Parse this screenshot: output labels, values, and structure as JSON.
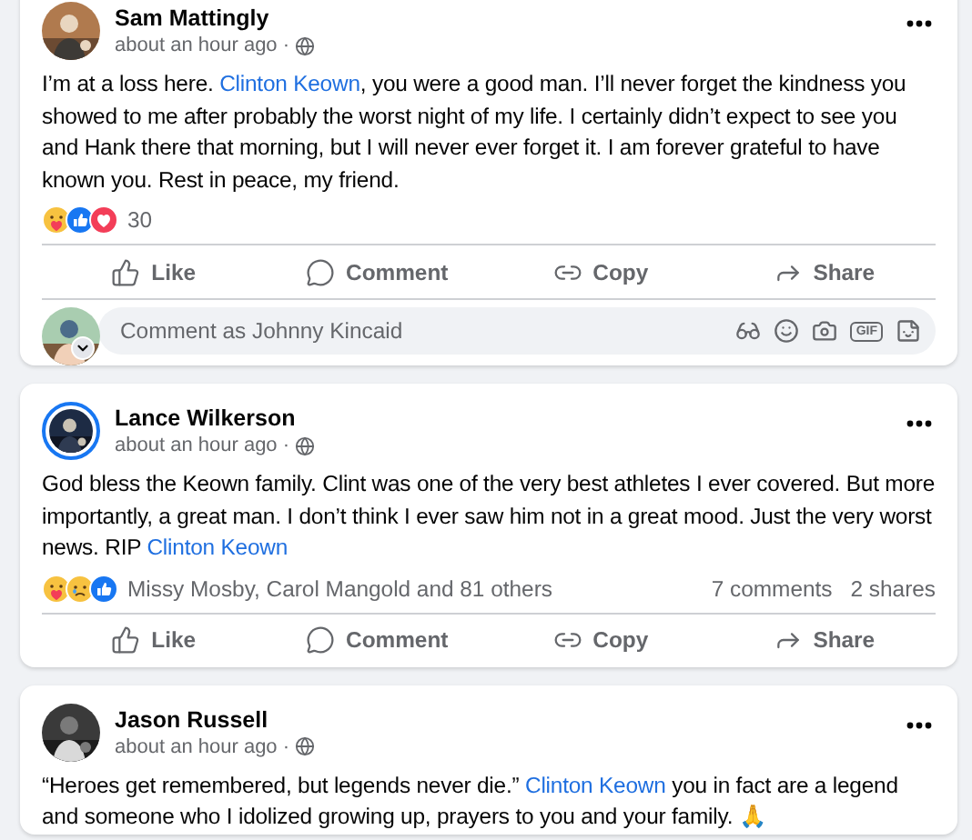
{
  "posts": [
    {
      "author": "Sam Mattingly",
      "time": "about an hour ago",
      "separator": "·",
      "story_ring": false,
      "body": [
        {
          "kind": "text",
          "text": "I’m at a loss here. "
        },
        {
          "kind": "mention",
          "text": "Clinton Keown"
        },
        {
          "kind": "text",
          "text": ", you were a good man. I’ll never forget the kindness you showed to me after probably the worst night of my life. I certainly didn’t expect to see you and Hank there that morning, but I will never ever forget it. I am forever grateful to have known you. Rest in peace, my friend."
        }
      ],
      "reactions": [
        {
          "kind": "care"
        },
        {
          "kind": "like"
        },
        {
          "kind": "love"
        }
      ],
      "reaction_summary": "30",
      "actions": [
        {
          "kind": "like",
          "label": "Like"
        },
        {
          "kind": "comment",
          "label": "Comment"
        },
        {
          "kind": "copy",
          "label": "Copy"
        },
        {
          "kind": "share",
          "label": "Share"
        }
      ],
      "comment_box": {
        "placeholder": "Comment as Johnny Kincaid",
        "gif_label": "GIF"
      }
    },
    {
      "author": "Lance Wilkerson",
      "time": "about an hour ago",
      "separator": "·",
      "story_ring": true,
      "body": [
        {
          "kind": "text",
          "text": "God bless the Keown family. Clint was one of the very best athletes I ever covered.  But more importantly, a great man. I don’t think I ever saw him not in a great mood. Just the very worst news. RIP "
        },
        {
          "kind": "mention",
          "text": "Clinton Keown"
        }
      ],
      "reactions": [
        {
          "kind": "care"
        },
        {
          "kind": "sad"
        },
        {
          "kind": "like"
        }
      ],
      "reaction_summary": "Missy Mosby, Carol Mangold and 81 others",
      "comments": "7 comments",
      "shares": "2 shares",
      "actions": [
        {
          "kind": "like",
          "label": "Like"
        },
        {
          "kind": "comment",
          "label": "Comment"
        },
        {
          "kind": "copy",
          "label": "Copy"
        },
        {
          "kind": "share",
          "label": "Share"
        }
      ]
    },
    {
      "author": "Jason Russell",
      "time": "about an hour ago",
      "separator": "·",
      "story_ring": false,
      "body": [
        {
          "kind": "text",
          "text": "“Heroes get remembered, but legends never die.” "
        },
        {
          "kind": "mention",
          "text": "Clinton Keown"
        },
        {
          "kind": "text",
          "text": " you in fact are a legend and someone who I idolized growing up, prayers to you and your family. 🙏"
        }
      ]
    }
  ]
}
